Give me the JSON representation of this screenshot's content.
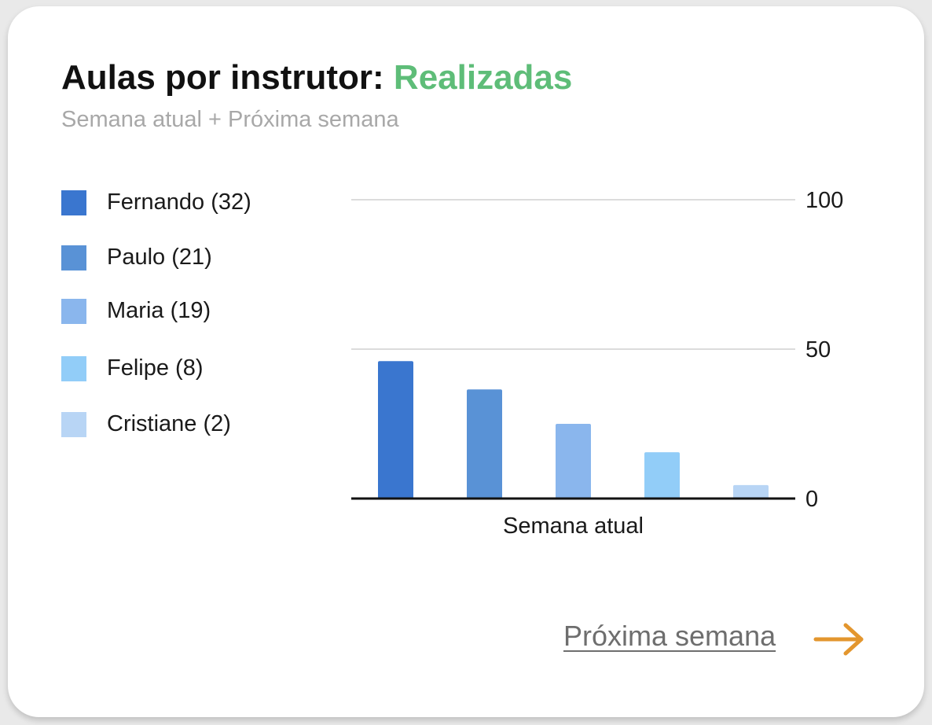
{
  "card": {
    "title_prefix": "Aulas por instrutor:",
    "title_status": "Realizadas",
    "subtitle": "Semana atual + Próxima semana"
  },
  "legend": [
    {
      "label": "Fernando (32)",
      "color": "#3a76cf"
    },
    {
      "label": "Paulo (21)",
      "color": "#5992d6"
    },
    {
      "label": "Maria (19)",
      "color": "#8ab6ed"
    },
    {
      "label": "Felipe (8)",
      "color": "#92cdf8"
    },
    {
      "label": "Cristiane (2)",
      "color": "#b8d5f5"
    }
  ],
  "chart_data": {
    "type": "bar",
    "categories": [
      "Semana atual"
    ],
    "series": [
      {
        "name": "Fernando (32)",
        "values": [
          46
        ],
        "color": "#3a76cf"
      },
      {
        "name": "Paulo (21)",
        "values": [
          36.5
        ],
        "color": "#5992d6"
      },
      {
        "name": "Maria (19)",
        "values": [
          25
        ],
        "color": "#8ab6ed"
      },
      {
        "name": "Felipe (8)",
        "values": [
          15.5
        ],
        "color": "#92cdf8"
      },
      {
        "name": "Cristiane (2)",
        "values": [
          4.5
        ],
        "color": "#b8d5f5"
      }
    ],
    "y_ticks": [
      "0",
      "50",
      "100"
    ],
    "ylim": [
      0,
      100
    ],
    "y_axis_position": "right",
    "grid": true,
    "legend_position": "left"
  },
  "footer": {
    "next_week_link": "Próxima semana",
    "arrow_icon": "arrow-right-icon",
    "arrow_color": "#e3962e"
  }
}
